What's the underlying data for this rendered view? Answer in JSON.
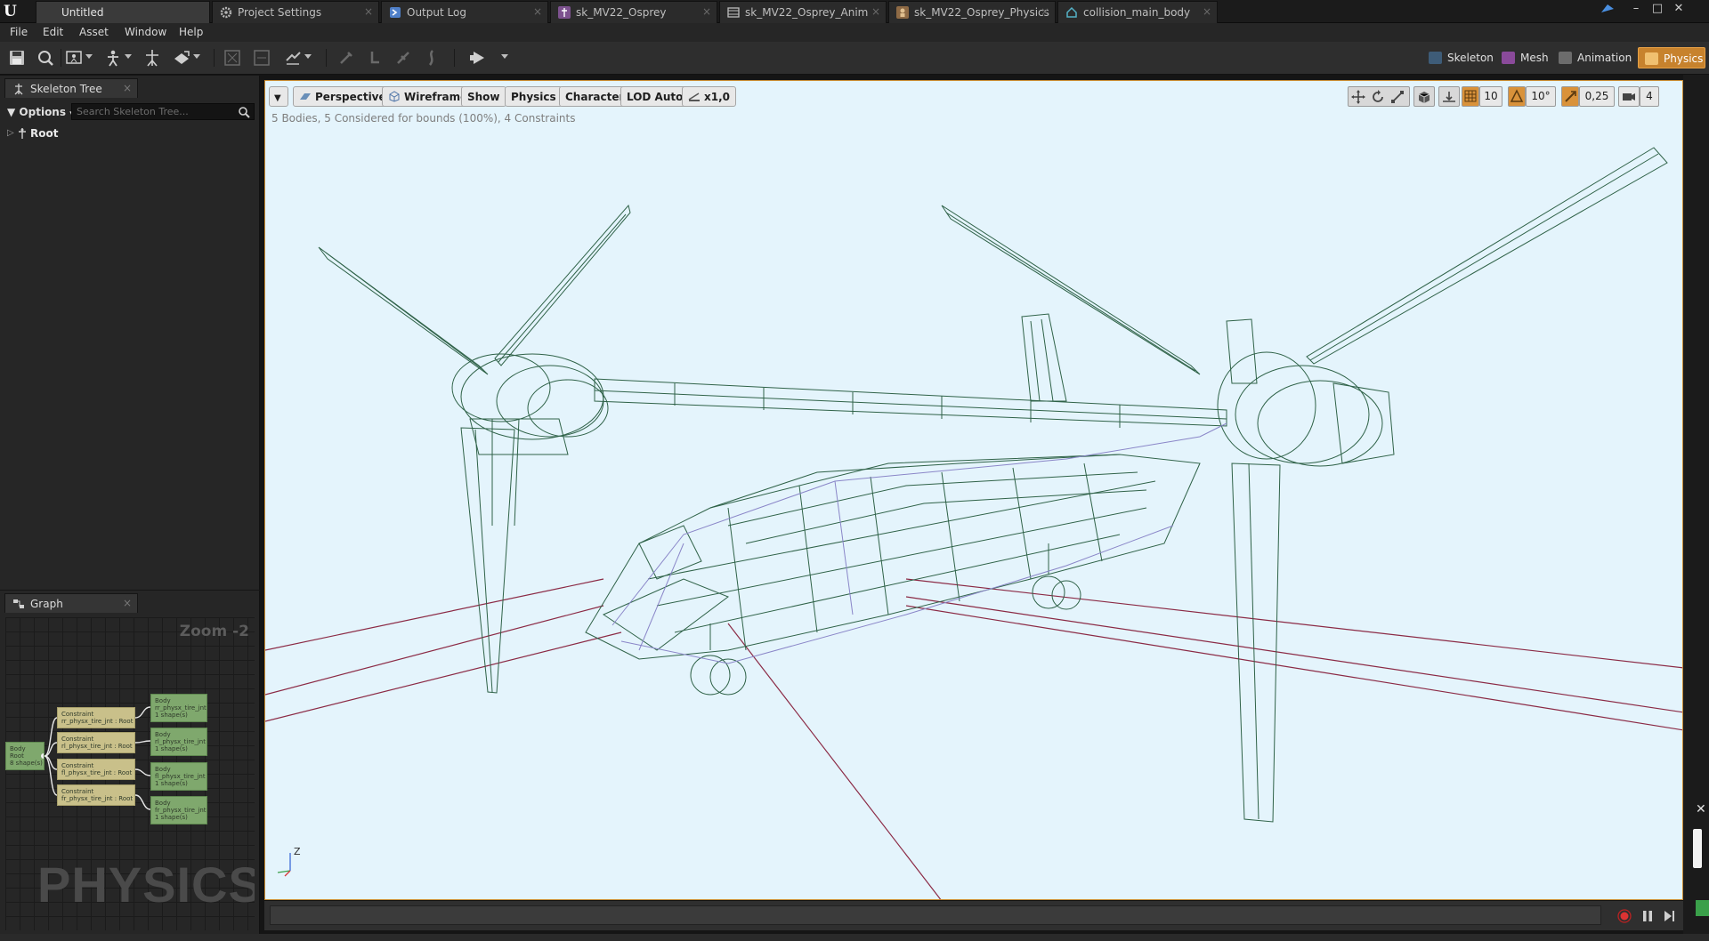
{
  "window": {
    "tabs": [
      {
        "label": "Untitled",
        "icon": "ue-logo-icon",
        "color": "#3a3a3a"
      },
      {
        "label": "Project Settings",
        "icon": "settings-icon",
        "color": "#9a9a9a"
      },
      {
        "label": "Output Log",
        "icon": "output-log-icon",
        "color": "#5b8ed8"
      },
      {
        "label": "sk_MV22_Osprey",
        "icon": "skeleton-asset-icon",
        "color": "#8a5fa8"
      },
      {
        "label": "sk_MV22_Osprey_Anim",
        "icon": "anim-asset-icon",
        "color": "#8a8a8a"
      },
      {
        "label": "sk_MV22_Osprey_Physics",
        "icon": "physics-asset-icon",
        "color": "#b08050"
      },
      {
        "label": "collision_main_body",
        "icon": "static-mesh-icon",
        "color": "#4ea3b8"
      }
    ]
  },
  "menu": [
    "File",
    "Edit",
    "Asset",
    "Window",
    "Help"
  ],
  "toolbar": {
    "modes": [
      {
        "label": "Skeleton",
        "icon": "skeleton-mode-icon",
        "active": false
      },
      {
        "label": "Mesh",
        "icon": "mesh-mode-icon",
        "active": false
      },
      {
        "label": "Animation",
        "icon": "animation-mode-icon",
        "active": false
      },
      {
        "label": "Physics",
        "icon": "physics-mode-icon",
        "active": true
      }
    ]
  },
  "skeleton_tree": {
    "tab_label": "Skeleton Tree",
    "options_label": "Options",
    "search_placeholder": "Search Skeleton Tree...",
    "root_label": "Root"
  },
  "graph": {
    "tab_label": "Graph",
    "zoom": "Zoom -2",
    "watermark": "PHYSICS",
    "root_node": {
      "line1": "Body",
      "line2": "Root",
      "line3": "8 shape(s)"
    },
    "constraints": [
      {
        "line1": "Constraint",
        "line2": "rr_physx_tire_jnt : Root"
      },
      {
        "line1": "Constraint",
        "line2": "rl_physx_tire_jnt : Root"
      },
      {
        "line1": "Constraint",
        "line2": "fl_physx_tire_jnt : Root"
      },
      {
        "line1": "Constraint",
        "line2": "fr_physx_tire_jnt : Root"
      }
    ],
    "bodies": [
      {
        "line1": "Body",
        "line2": "rr_physx_tire_jnt",
        "line3": "1 shape(s)"
      },
      {
        "line1": "Body",
        "line2": "rl_physx_tire_jnt",
        "line3": "1 shape(s)"
      },
      {
        "line1": "Body",
        "line2": "fl_physx_tire_jnt",
        "line3": "1 shape(s)"
      },
      {
        "line1": "Body",
        "line2": "fr_physx_tire_jnt",
        "line3": "1 shape(s)"
      }
    ]
  },
  "viewport": {
    "buttons": {
      "perspective": "Perspective",
      "wireframe": "Wireframe",
      "show": "Show",
      "physics": "Physics",
      "character": "Character",
      "lod": "LOD Auto",
      "speed": "x1,0"
    },
    "info": "5 Bodies, 5 Considered for bounds (100%), 4 Constraints",
    "grid_snap": "10",
    "rotation_snap": "10°",
    "scale_snap": "0,25",
    "camera_speed": "4",
    "axis_label": "Z",
    "background": "#e4f4fc",
    "wire_color": "#2f6248",
    "collision_color": "#8a86c8",
    "line_color": "#8b2a45"
  }
}
